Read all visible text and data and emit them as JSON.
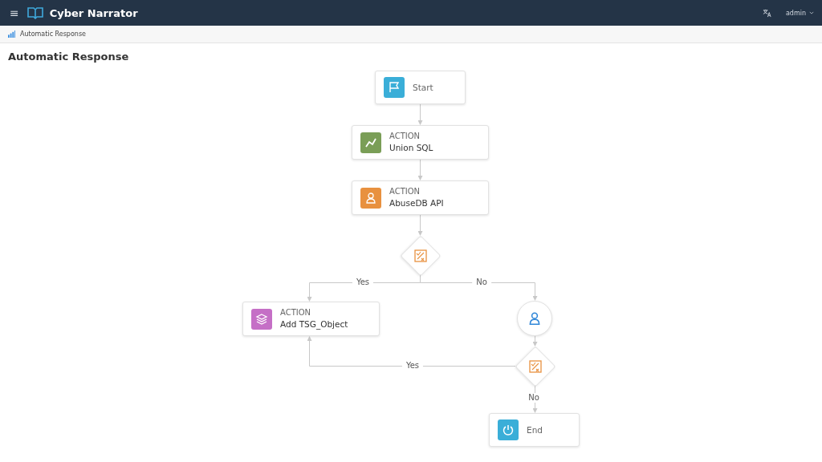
{
  "header": {
    "menu_glyph": "≡",
    "app_name": "Cyber Narrator",
    "user": "admin"
  },
  "breadcrumb": "Automatic Response",
  "page_title": "Automatic Response",
  "nodes": [
    {
      "kind": "start",
      "label": "Start",
      "color": "#3aaed8"
    },
    {
      "kind": "action",
      "caption": "ACTION",
      "label": "Union SQL",
      "color": "#7a9e57"
    },
    {
      "kind": "action",
      "caption": "ACTION",
      "label": "AbuseDB API",
      "color": "#e8913f"
    },
    {
      "kind": "condition"
    },
    {
      "kind": "action",
      "caption": "ACTION",
      "label": "Add TSG_Object",
      "color": "#c56fc6"
    },
    {
      "kind": "user"
    },
    {
      "kind": "condition"
    },
    {
      "kind": "end",
      "label": "End",
      "color": "#3aaed8"
    }
  ],
  "edge_labels": [
    "Yes",
    "No",
    "Yes",
    "No"
  ]
}
